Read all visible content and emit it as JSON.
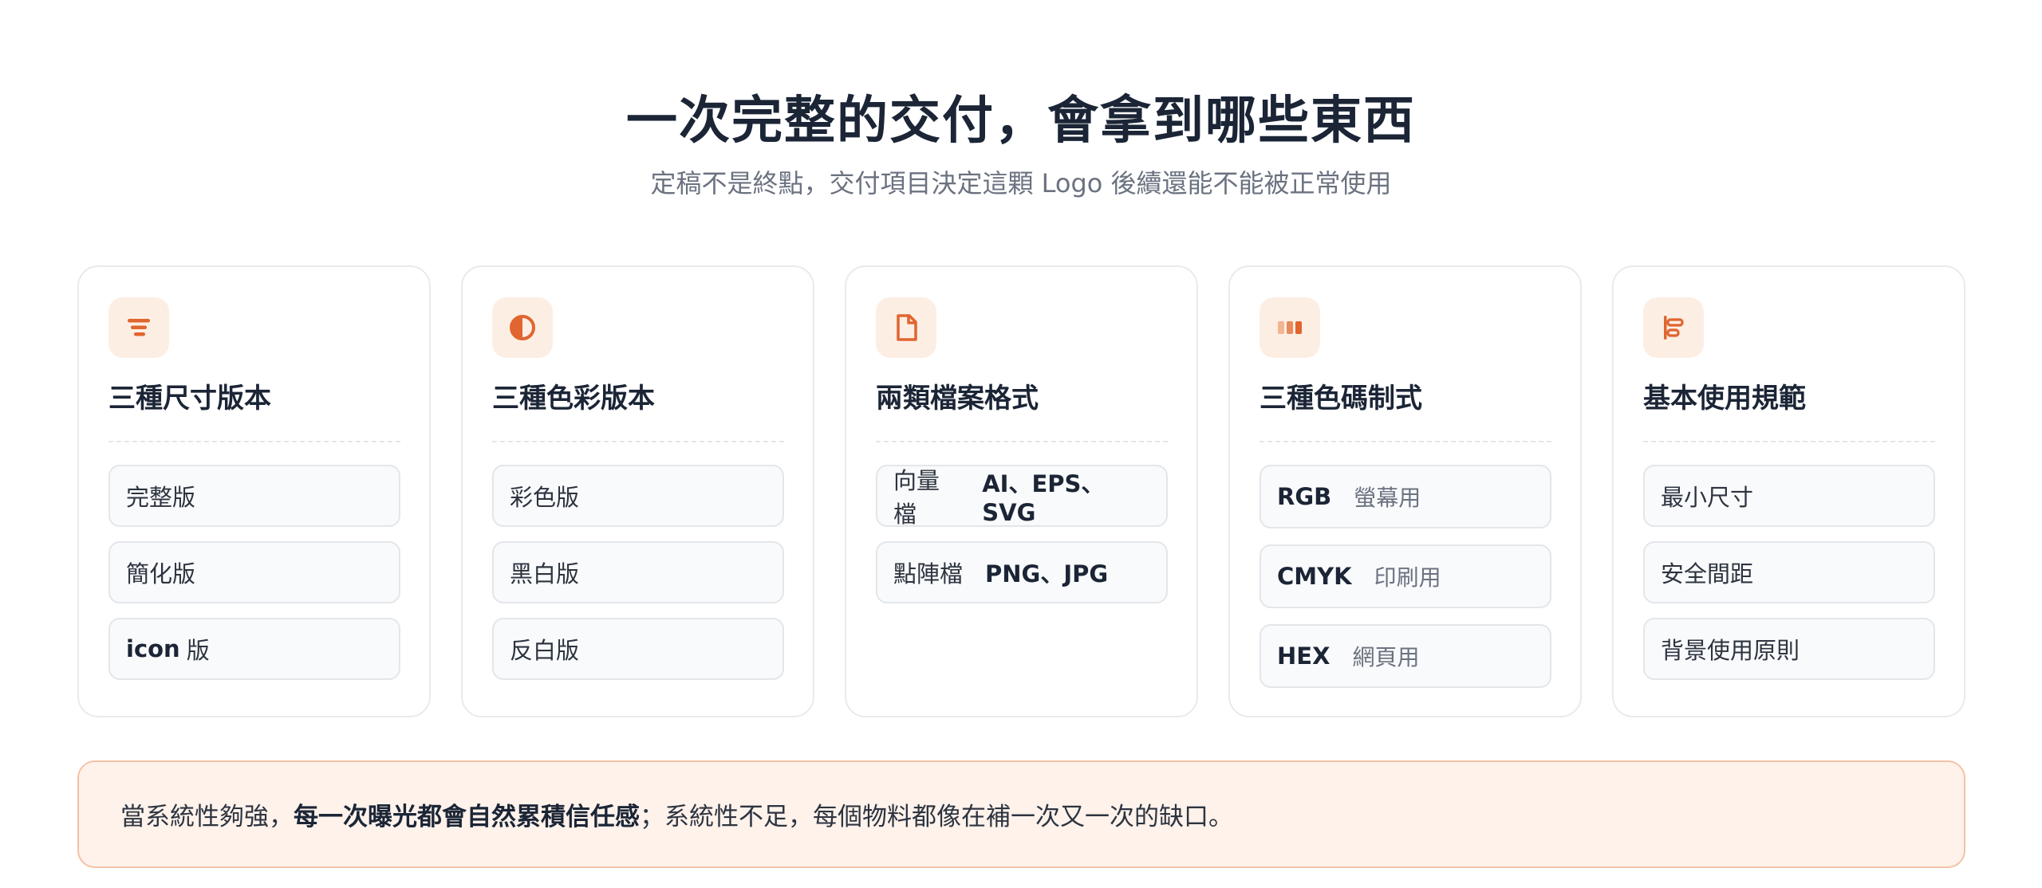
{
  "header": {
    "title": "一次完整的交付，會拿到哪些東西",
    "subtitle": "定稿不是終點，交付項目決定這顆 Logo 後續還能不能被正常使用"
  },
  "accent_color": "#e0652f",
  "cards": [
    {
      "icon": "filter-lines-icon",
      "title": "三種尺寸版本",
      "items": [
        {
          "label": "完整版"
        },
        {
          "label": "簡化版"
        },
        {
          "strong": "icon",
          "suffix": "版"
        }
      ]
    },
    {
      "icon": "half-circle-contrast-icon",
      "title": "三種色彩版本",
      "items": [
        {
          "label": "彩色版"
        },
        {
          "label": "黑白版"
        },
        {
          "label": "反白版"
        }
      ]
    },
    {
      "icon": "document-icon",
      "title": "兩類檔案格式",
      "items": [
        {
          "label": "向量檔",
          "value": "AI、EPS、SVG"
        },
        {
          "label": "點陣檔",
          "value": "PNG、JPG"
        }
      ]
    },
    {
      "icon": "color-swatches-icon",
      "title": "三種色碼制式",
      "items": [
        {
          "code": "RGB",
          "use": "螢幕用"
        },
        {
          "code": "CMYK",
          "use": "印刷用"
        },
        {
          "code": "HEX",
          "use": "網頁用"
        }
      ]
    },
    {
      "icon": "align-left-bars-icon",
      "title": "基本使用規範",
      "items": [
        {
          "label": "最小尺寸"
        },
        {
          "label": "安全間距"
        },
        {
          "label": "背景使用原則"
        }
      ]
    }
  ],
  "banner": {
    "before": "當系統性夠強，",
    "bold": "每一次曝光都會自然累積信任感",
    "after": "；系統性不足，每個物料都像在補一次又一次的缺口。"
  }
}
